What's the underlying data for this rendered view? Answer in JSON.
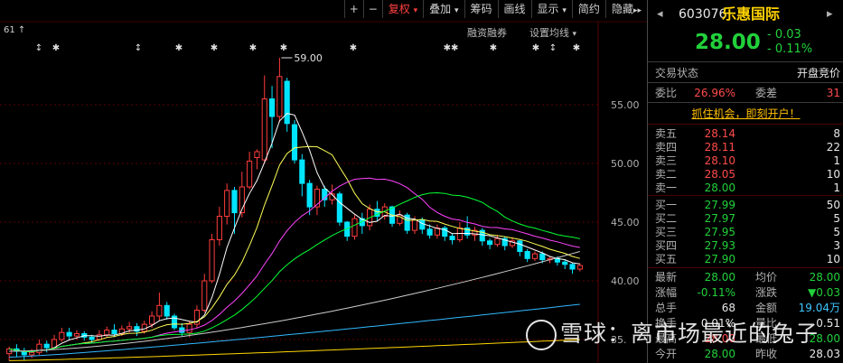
{
  "toolbar": {
    "plus": "+",
    "minus": "−",
    "fuquan": "复权",
    "fuquan_arrow": "▾",
    "diejia": "叠加",
    "diejia_arrow": "▾",
    "chouma": "筹码",
    "huaxian": "画线",
    "xianshi": "显示",
    "xianshi_arrow": "▾",
    "jianyue": "简约",
    "yincang": "隐藏",
    "collapse": "▸▸"
  },
  "chart": {
    "level_label": "61",
    "rzrq": "融资融券",
    "ma_setting": "设置均线",
    "ma_arrow": "▾",
    "max_label": "59.00",
    "yticks": [
      "55.00",
      "50.00",
      "45.00",
      "40.00",
      "35."
    ],
    "markers_row1": [
      "↕",
      "✱",
      "↕",
      "✱",
      "✱",
      "✱",
      "✱",
      "✱",
      "✱✱",
      "✱",
      "✱",
      "↕",
      "✱",
      "✱"
    ]
  },
  "chart_data": {
    "type": "candlestick",
    "title": "",
    "ylim": [
      33,
      61
    ],
    "high_label": 59.0,
    "ticks": [
      55,
      50,
      45,
      40,
      35
    ],
    "candles": [
      [
        33.8,
        34.2,
        33.2,
        34.4
      ],
      [
        34.2,
        34.0,
        33.5,
        34.6
      ],
      [
        34.0,
        33.7,
        33.2,
        34.3
      ],
      [
        33.7,
        33.9,
        33.4,
        34.2
      ],
      [
        33.9,
        34.6,
        33.7,
        35.0
      ],
      [
        34.6,
        34.3,
        33.9,
        34.9
      ],
      [
        34.3,
        35.0,
        34.2,
        35.4
      ],
      [
        35.0,
        35.6,
        34.8,
        36.0
      ],
      [
        35.6,
        35.3,
        35.0,
        36.0
      ],
      [
        35.3,
        35.5,
        35.0,
        35.8
      ],
      [
        35.5,
        35.2,
        34.9,
        35.7
      ],
      [
        35.2,
        35.0,
        34.7,
        35.4
      ],
      [
        35.0,
        35.4,
        34.9,
        35.8
      ],
      [
        35.4,
        35.8,
        35.2,
        36.1
      ],
      [
        35.8,
        35.5,
        35.2,
        36.3
      ],
      [
        35.5,
        35.9,
        35.3,
        36.2
      ],
      [
        35.9,
        36.1,
        35.6,
        36.5
      ],
      [
        36.1,
        35.7,
        35.3,
        36.4
      ],
      [
        35.7,
        36.3,
        35.5,
        36.6
      ],
      [
        36.3,
        37.0,
        36.0,
        37.4
      ],
      [
        37.0,
        37.9,
        36.6,
        39.0
      ],
      [
        37.9,
        37.0,
        36.7,
        38.2
      ],
      [
        37.0,
        36.0,
        35.8,
        37.2
      ],
      [
        36.0,
        35.6,
        35.3,
        36.4
      ],
      [
        35.6,
        36.3,
        35.2,
        36.6
      ],
      [
        36.3,
        37.5,
        36.0,
        37.9
      ],
      [
        37.5,
        40.0,
        37.3,
        40.6
      ],
      [
        40.0,
        43.5,
        39.8,
        44.0
      ],
      [
        43.5,
        45.5,
        43.0,
        46.3
      ],
      [
        45.5,
        47.7,
        44.8,
        48.3
      ],
      [
        47.7,
        45.8,
        44.0,
        48.0
      ],
      [
        45.8,
        48.0,
        45.4,
        49.3
      ],
      [
        48.0,
        50.2,
        47.8,
        51.0
      ],
      [
        50.5,
        51.0,
        49.5,
        51.2
      ],
      [
        50.3,
        55.5,
        50.0,
        57.5
      ],
      [
        55.5,
        54.0,
        51.3,
        56.6
      ],
      [
        54.0,
        57.4,
        53.5,
        59.0
      ],
      [
        57.0,
        53.4,
        52.7,
        57.3
      ],
      [
        53.3,
        50.3,
        50.0,
        53.7
      ],
      [
        50.3,
        48.3,
        47.2,
        50.8
      ],
      [
        48.3,
        46.3,
        45.6,
        48.6
      ],
      [
        46.3,
        47.8,
        45.6,
        48.1
      ],
      [
        47.8,
        46.9,
        46.3,
        48.1
      ],
      [
        46.9,
        47.4,
        46.5,
        48.2
      ],
      [
        47.4,
        45.0,
        44.7,
        47.6
      ],
      [
        45.0,
        43.8,
        43.4,
        45.1
      ],
      [
        43.8,
        45.3,
        43.5,
        45.6
      ],
      [
        45.3,
        44.7,
        44.0,
        45.8
      ],
      [
        44.7,
        46.1,
        44.3,
        46.5
      ],
      [
        46.1,
        45.5,
        45.1,
        46.8
      ],
      [
        45.5,
        46.3,
        45.2,
        46.6
      ],
      [
        46.3,
        44.9,
        44.6,
        46.4
      ],
      [
        44.9,
        45.6,
        44.7,
        46.0
      ],
      [
        45.6,
        44.3,
        44.0,
        45.8
      ],
      [
        44.3,
        45.2,
        44.0,
        45.5
      ],
      [
        45.2,
        44.4,
        44.0,
        45.4
      ],
      [
        44.4,
        43.9,
        43.6,
        44.8
      ],
      [
        43.9,
        44.5,
        43.6,
        44.8
      ],
      [
        44.5,
        43.8,
        43.4,
        44.7
      ],
      [
        43.8,
        43.5,
        43.1,
        44.0
      ],
      [
        43.5,
        44.5,
        43.3,
        45.0
      ],
      [
        44.5,
        43.9,
        43.6,
        45.5
      ],
      [
        43.9,
        44.3,
        43.4,
        44.6
      ],
      [
        44.3,
        43.4,
        43.0,
        44.5
      ],
      [
        43.4,
        43.1,
        42.7,
        43.6
      ],
      [
        43.1,
        43.6,
        42.9,
        43.9
      ],
      [
        43.6,
        43.0,
        42.6,
        43.8
      ],
      [
        43.0,
        43.4,
        42.8,
        43.7
      ],
      [
        43.4,
        42.5,
        42.1,
        43.5
      ],
      [
        42.5,
        41.9,
        41.6,
        42.7
      ],
      [
        41.9,
        42.3,
        41.7,
        42.5
      ],
      [
        42.3,
        41.8,
        41.5,
        42.5
      ],
      [
        41.8,
        41.9,
        41.5,
        42.1
      ],
      [
        41.9,
        41.6,
        41.3,
        42.1
      ],
      [
        41.6,
        41.4,
        41.0,
        41.8
      ],
      [
        41.4,
        41.0,
        40.6,
        41.5
      ],
      [
        41.0,
        41.3,
        40.8,
        41.5
      ]
    ],
    "ma_colors": [
      "#ffffff",
      "#ffff55",
      "#ff44ff",
      "#00ff33",
      "#cccccc",
      "#33b8ff",
      "#ffd700"
    ]
  },
  "side": {
    "code": "603076",
    "name": "乐惠国际",
    "price": "28.00",
    "change": "- 0.03",
    "change_pct": "- 0.11%",
    "trade_status_label": "交易状态",
    "trade_status_value": "开盘竞价",
    "weibi_label": "委比",
    "weibi_value": "26.96%",
    "weicha_label": "委差",
    "weicha_value": "31",
    "ad": "抓住机会，即刻开户！",
    "asks": [
      {
        "label": "卖五",
        "price": "28.14",
        "vol": "8"
      },
      {
        "label": "卖四",
        "price": "28.11",
        "vol": "22"
      },
      {
        "label": "卖三",
        "price": "28.10",
        "vol": "1"
      },
      {
        "label": "卖二",
        "price": "28.05",
        "vol": "10"
      },
      {
        "label": "卖一",
        "price": "28.00",
        "vol": "1"
      }
    ],
    "bids": [
      {
        "label": "买一",
        "price": "27.99",
        "vol": "50"
      },
      {
        "label": "买二",
        "price": "27.97",
        "vol": "5"
      },
      {
        "label": "买三",
        "price": "27.95",
        "vol": "5"
      },
      {
        "label": "买四",
        "price": "27.93",
        "vol": "3"
      },
      {
        "label": "买五",
        "price": "27.90",
        "vol": "10"
      }
    ],
    "stats": [
      {
        "l1": "最新",
        "v1": "28.00",
        "l2": "均价",
        "v2": "28.00"
      },
      {
        "l1": "涨幅",
        "v1": "-0.11%",
        "l2": "涨跌",
        "v2": "▼0.03"
      },
      {
        "l1": "总手",
        "v1": "68",
        "l2": "金额",
        "v2": "19.04万"
      },
      {
        "l1": "换手",
        "v1": "0.01%",
        "l2": "量比",
        "v2": "0.51"
      },
      {
        "l1": "最高",
        "v1": "28.00",
        "l2": "最低",
        "v2": "28.00"
      },
      {
        "l1": "今开",
        "v1": "28.00",
        "l2": "昨收",
        "v2": "28.03"
      }
    ]
  },
  "watermark": {
    "text": "雪球：离市场最近的兔子"
  }
}
